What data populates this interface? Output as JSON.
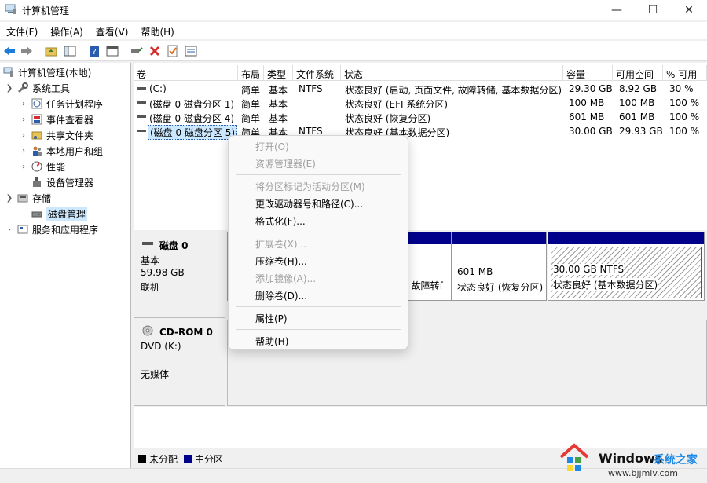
{
  "window": {
    "title": "计算机管理"
  },
  "menubar": [
    "文件(F)",
    "操作(A)",
    "查看(V)",
    "帮助(H)"
  ],
  "tree": {
    "root": "计算机管理(本地)",
    "system_tools": "系统工具",
    "task_scheduler": "任务计划程序",
    "event_viewer": "事件查看器",
    "shared_folders": "共享文件夹",
    "local_users": "本地用户和组",
    "performance": "性能",
    "device_manager": "设备管理器",
    "storage": "存储",
    "disk_management": "磁盘管理",
    "services_apps": "服务和应用程序"
  },
  "volume_columns": [
    "卷",
    "布局",
    "类型",
    "文件系统",
    "状态",
    "容量",
    "可用空间",
    "% 可用"
  ],
  "volumes": [
    {
      "name": "(C:)",
      "layout": "简单",
      "type": "基本",
      "fs": "NTFS",
      "status": "状态良好 (启动, 页面文件, 故障转储, 基本数据分区)",
      "capacity": "29.30 GB",
      "free": "8.92 GB",
      "pct": "30 %"
    },
    {
      "name": "(磁盘 0 磁盘分区 1)",
      "layout": "简单",
      "type": "基本",
      "fs": "",
      "status": "状态良好 (EFI 系统分区)",
      "capacity": "100 MB",
      "free": "100 MB",
      "pct": "100 %"
    },
    {
      "name": "(磁盘 0 磁盘分区 4)",
      "layout": "简单",
      "type": "基本",
      "fs": "",
      "status": "状态良好 (恢复分区)",
      "capacity": "601 MB",
      "free": "601 MB",
      "pct": "100 %"
    },
    {
      "name": "(磁盘 0 磁盘分区 5)",
      "layout": "简单",
      "type": "基本",
      "fs": "NTFS",
      "status": "状态良好 (基本数据分区)",
      "capacity": "30.00 GB",
      "free": "29.93 GB",
      "pct": "100 %"
    }
  ],
  "disk0": {
    "name": "磁盘 0",
    "type": "基本",
    "size": "59.98 GB",
    "state": "联机",
    "part_c_status_fragment": ", 故障转f",
    "part4_size": "601 MB",
    "part4_status": "状态良好 (恢复分区)",
    "part5_size": "30.00 GB NTFS",
    "part5_status": "状态良好 (基本数据分区)"
  },
  "cdrom0": {
    "name": "CD-ROM 0",
    "drive": "DVD (K:)",
    "media": "无媒体"
  },
  "legend": {
    "unallocated": "未分配",
    "primary": "主分区"
  },
  "context_menu": {
    "open": "打开(O)",
    "explorer": "资源管理器(E)",
    "mark_active": "将分区标记为活动分区(M)",
    "change_letter": "更改驱动器号和路径(C)...",
    "format": "格式化(F)...",
    "extend": "扩展卷(X)...",
    "shrink": "压缩卷(H)...",
    "add_mirror": "添加镜像(A)...",
    "delete": "删除卷(D)...",
    "properties": "属性(P)",
    "help": "帮助(H)"
  },
  "watermark": {
    "brand": "Windows",
    "site": "系统之家",
    "url": "www.bjjmlv.com"
  },
  "colors": {
    "primary_partition": "#00008b",
    "selection": "#cce8ff",
    "unallocated": "#000000"
  }
}
